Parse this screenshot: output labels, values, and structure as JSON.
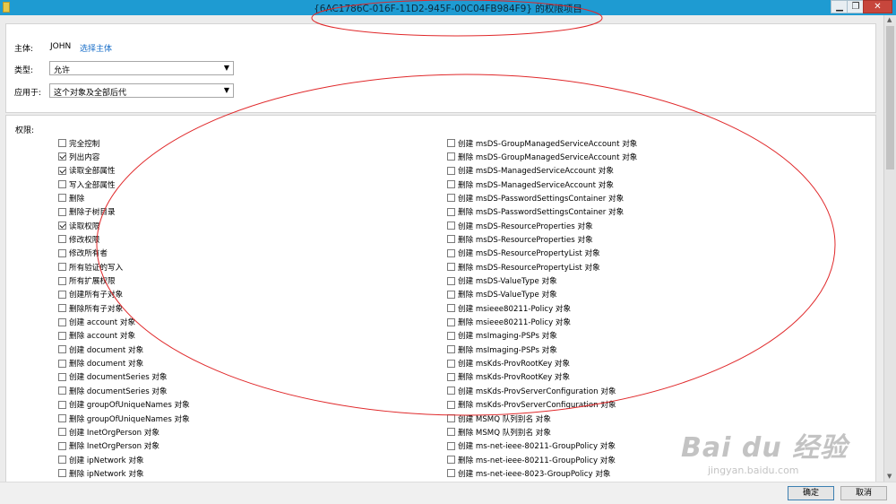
{
  "window": {
    "title": "{6AC1786C-016F-11D2-945F-00C04FB984F9} 的权限项目",
    "min_glyph": "▁",
    "max_glyph": "❐",
    "close_glyph": "✕"
  },
  "principal": {
    "label": "主体:",
    "name": "JOHN",
    "select_link": "选择主体"
  },
  "type": {
    "label": "类型:",
    "value": "允许"
  },
  "applies_to": {
    "label": "应用于:",
    "value": "这个对象及全部后代"
  },
  "permissions": {
    "label": "权限:",
    "left": [
      {
        "label": "完全控制",
        "checked": false
      },
      {
        "label": "列出内容",
        "checked": true
      },
      {
        "label": "读取全部属性",
        "checked": true
      },
      {
        "label": "写入全部属性",
        "checked": false
      },
      {
        "label": "删除",
        "checked": false
      },
      {
        "label": "删除子树目录",
        "checked": false
      },
      {
        "label": "读取权限",
        "checked": true
      },
      {
        "label": "修改权限",
        "checked": false
      },
      {
        "label": "修改所有者",
        "checked": false
      },
      {
        "label": "所有验证的写入",
        "checked": false
      },
      {
        "label": "所有扩展权限",
        "checked": false
      },
      {
        "label": "创建所有子对象",
        "checked": false
      },
      {
        "label": "删除所有子对象",
        "checked": false
      },
      {
        "label": "创建 account 对象",
        "checked": false
      },
      {
        "label": "删除 account 对象",
        "checked": false
      },
      {
        "label": "创建 document 对象",
        "checked": false
      },
      {
        "label": "删除 document 对象",
        "checked": false
      },
      {
        "label": "创建 documentSeries 对象",
        "checked": false
      },
      {
        "label": "删除 documentSeries 对象",
        "checked": false
      },
      {
        "label": "创建 groupOfUniqueNames 对象",
        "checked": false
      },
      {
        "label": "删除 groupOfUniqueNames 对象",
        "checked": false
      },
      {
        "label": "创建 InetOrgPerson 对象",
        "checked": false
      },
      {
        "label": "删除 InetOrgPerson 对象",
        "checked": false
      },
      {
        "label": "创建 ipNetwork 对象",
        "checked": false
      },
      {
        "label": "删除 ipNetwork 对象",
        "checked": false
      }
    ],
    "right": [
      {
        "label": "创建 msDS-GroupManagedServiceAccount 对象",
        "checked": false
      },
      {
        "label": "删除 msDS-GroupManagedServiceAccount 对象",
        "checked": false
      },
      {
        "label": "创建 msDS-ManagedServiceAccount 对象",
        "checked": false
      },
      {
        "label": "删除 msDS-ManagedServiceAccount 对象",
        "checked": false
      },
      {
        "label": "创建 msDS-PasswordSettingsContainer 对象",
        "checked": false
      },
      {
        "label": "删除 msDS-PasswordSettingsContainer 对象",
        "checked": false
      },
      {
        "label": "创建 msDS-ResourceProperties 对象",
        "checked": false
      },
      {
        "label": "删除 msDS-ResourceProperties 对象",
        "checked": false
      },
      {
        "label": "创建 msDS-ResourcePropertyList 对象",
        "checked": false
      },
      {
        "label": "删除 msDS-ResourcePropertyList 对象",
        "checked": false
      },
      {
        "label": "创建 msDS-ValueType 对象",
        "checked": false
      },
      {
        "label": "删除 msDS-ValueType 对象",
        "checked": false
      },
      {
        "label": "创建 msieee80211-Policy 对象",
        "checked": false
      },
      {
        "label": "删除 msieee80211-Policy 对象",
        "checked": false
      },
      {
        "label": "创建 msImaging-PSPs 对象",
        "checked": false
      },
      {
        "label": "删除 msImaging-PSPs 对象",
        "checked": false
      },
      {
        "label": "创建 msKds-ProvRootKey 对象",
        "checked": false
      },
      {
        "label": "删除 msKds-ProvRootKey 对象",
        "checked": false
      },
      {
        "label": "创建 msKds-ProvServerConfiguration 对象",
        "checked": false
      },
      {
        "label": "删除 msKds-ProvServerConfiguration 对象",
        "checked": false
      },
      {
        "label": "创建 MSMQ 队列别名 对象",
        "checked": false
      },
      {
        "label": "删除 MSMQ 队列别名 对象",
        "checked": false
      },
      {
        "label": "创建 ms-net-ieee-80211-GroupPolicy 对象",
        "checked": false
      },
      {
        "label": "删除 ms-net-ieee-80211-GroupPolicy 对象",
        "checked": false
      },
      {
        "label": "创建 ms-net-ieee-8023-GroupPolicy 对象",
        "checked": false
      }
    ]
  },
  "footer": {
    "ok": "确定",
    "cancel": "取消"
  },
  "watermark": {
    "main": "Bai du 经验",
    "sub": "jingyan.baidu.com"
  },
  "colors": {
    "titlebar": "#1e9bd2",
    "link": "#1a6fc9",
    "annotation": "#e0282a"
  }
}
